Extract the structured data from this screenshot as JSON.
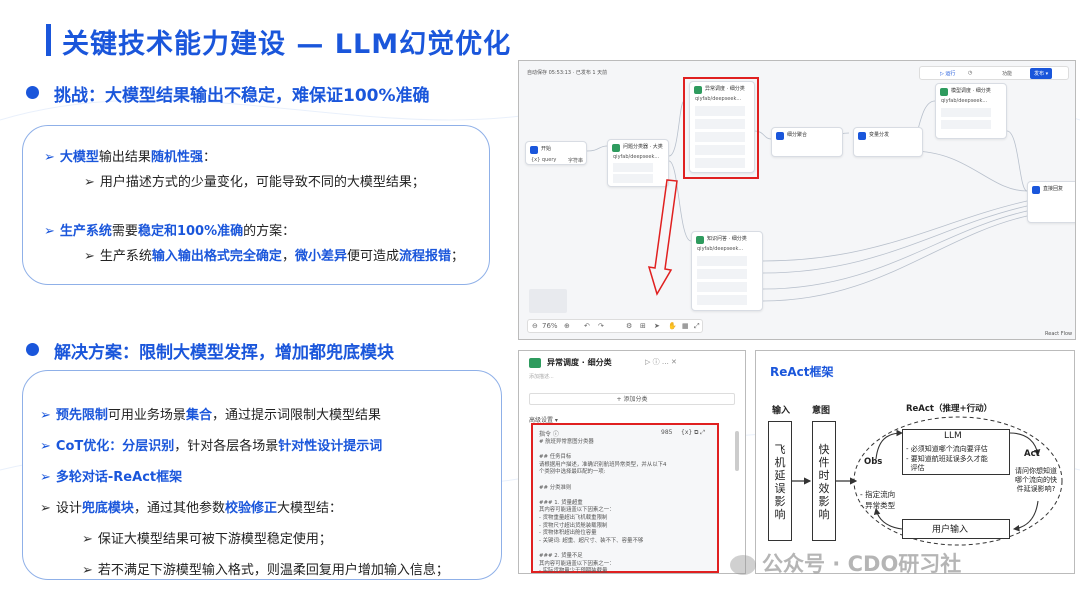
{
  "title": "关键技术能力建设 — LLM幻觉优化",
  "challenge": {
    "heading": "挑战：大模型结果输出不稳定，难保证100%准确",
    "l1_a": "大模型",
    "l1_b": "输出结果",
    "l1_c": "随机性强",
    "l1_d": "：",
    "l2": "用户描述方式的少量变化，可能导致不同的大模型结果；",
    "l3_a": "生产系统",
    "l3_b": "需要",
    "l3_c": "稳定和100%准确",
    "l3_d": "的方案：",
    "l4_a": "生产系统",
    "l4_b": "输入输出格式完全确定",
    "l4_c": "，",
    "l4_d": "微小差异",
    "l4_e": "便可造成",
    "l4_f": "流程报错",
    "l4_g": "；"
  },
  "solution": {
    "heading": "解决方案：限制大模型发挥，增加都兜底模块",
    "s1_a": "预先限制",
    "s1_b": "可用业务场景",
    "s1_c": "集合",
    "s1_d": "，通过提示词限制大模型结果",
    "s2_a": "CoT优化：分层识别",
    "s2_b": "，针对各层各场景",
    "s2_c": "针对性设计提示词",
    "s3": "多轮对话-ReAct框架",
    "s4_a": "设计",
    "s4_b": "兜底模块",
    "s4_c": "，通过其他参数",
    "s4_d": "校验修正",
    "s4_e": "大模型结：",
    "s5": "保证大模型结果可被下游模型稳定使用；",
    "s6": "若不满足下游模型输入格式，则温柔回复用户增加输入信息；"
  },
  "workflow": {
    "top_info": "自动保存 05:53:13 · 已发布 1 天前",
    "run": "▷ 运行",
    "func": "功能",
    "publish": "发布 ▾",
    "zoom": "76%",
    "footer": "React Flow",
    "nodes": {
      "start": "开始",
      "start_var": "{x} query",
      "start_type": "字符串",
      "intent": "问题分类器 · 大类",
      "intent_model": "qiyfab/deepseek...",
      "anomaly": "异常调度 · 细分类",
      "anomaly_model": "qiyfab/deepseek...",
      "category": "知识问答 · 细分类",
      "category_model": "qiyfab/deepseek...",
      "mid_node": "细分聚合",
      "end_node": "变量分发",
      "reply": "模型调度 · 细分类",
      "reply_model": "qiyfab/deepseek...",
      "final": "直接回复"
    }
  },
  "prompt_panel": {
    "title": "异常调度 · 细分类",
    "sub": "添加描述...",
    "add_class": "+ 添加分类",
    "advanced": "高级设置 ▾",
    "instr": "指令 ⓘ",
    "counter": "985",
    "lines": [
      "# 航班异常意图分类器",
      "",
      "## 任务目标",
      "请根据用户描述，准确识别航班异常类型，并从以下4",
      "个类别中选择最匹配的一项:",
      "",
      "## 分类准则",
      "",
      "### 1. 货量超重",
      "其内容可能涵盖以下因素之一：",
      "- 货物重量超出飞机载重限制",
      "- 货物尺寸超出货舱装载限制",
      "- 货物体积超出舱位容量",
      "- 关键词: 超重、超尺寸、装不下、容量不够",
      "",
      "### 2. 货量不足",
      "其内容可能涵盖以下因素之一：",
      "- 实际货物量少于预期装载量"
    ]
  },
  "react": {
    "title": "ReAct框架",
    "input_label": "输入",
    "intent_label": "意图",
    "react_label": "ReAct（推理+行动）",
    "input_box": "飞机延误影响",
    "intent_box": "快件时效影响",
    "llm": "LLM",
    "llm_l1": "- 必须知道哪个流向要评估",
    "llm_l2": "- 要知道航班延误多久才能",
    "llm_l3": "  评估",
    "obs": "Obs",
    "obs_l1": "- 指定流向",
    "obs_l2": "- 异常类型",
    "act": "Act",
    "act_q": "请问你想知道哪个流向的快件延误影响?",
    "user_input": "用户输入"
  },
  "watermark": "公众号 · CDO研习社"
}
